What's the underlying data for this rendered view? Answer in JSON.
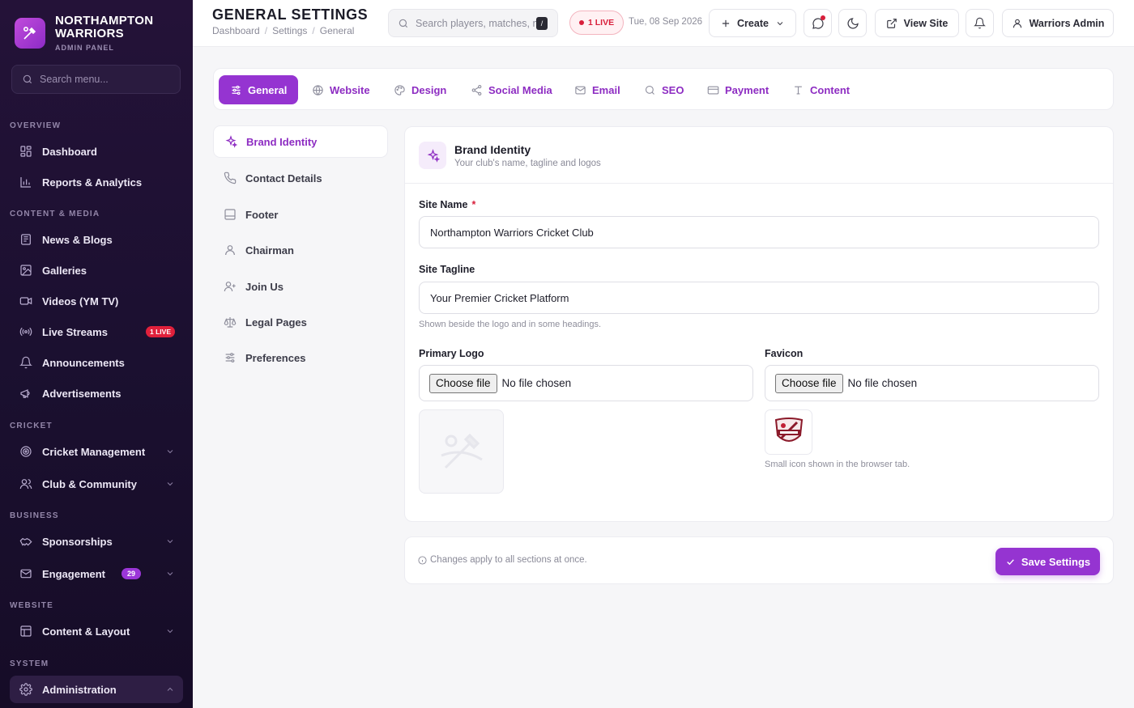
{
  "brand": {
    "name": "NORTHAMPTON WARRIORS",
    "subtitle": "ADMIN PANEL"
  },
  "sidebar": {
    "search_placeholder": "Search menu...",
    "sections": {
      "overview": "OVERVIEW",
      "content_media": "CONTENT & MEDIA",
      "cricket": "CRICKET",
      "business": "BUSINESS",
      "website": "WEBSITE",
      "system": "SYSTEM"
    },
    "items": {
      "dashboard": "Dashboard",
      "reports": "Reports & Analytics",
      "news": "News & Blogs",
      "galleries": "Galleries",
      "videos": "Videos (YM TV)",
      "live_streams": "Live Streams",
      "live_badge": "1 LIVE",
      "announcements": "Announcements",
      "advertisements": "Advertisements",
      "cricket_mgmt": "Cricket Management",
      "club": "Club & Community",
      "sponsorships": "Sponsorships",
      "engagement": "Engagement",
      "engagement_count": "29",
      "content_layout": "Content & Layout",
      "administration": "Administration"
    }
  },
  "header": {
    "title": "GENERAL SETTINGS",
    "breadcrumb": [
      "Dashboard",
      "Settings",
      "General"
    ],
    "breadcrumb_sep": "/",
    "search_placeholder": "Search players, matches, n",
    "search_shortcut": "/",
    "live": "1 LIVE",
    "date": "Tue, 08 Sep 2026",
    "create": "Create",
    "view_site": "View Site",
    "user": "Warriors Admin"
  },
  "tabs": [
    "General",
    "Website",
    "Design",
    "Social Media",
    "Email",
    "SEO",
    "Payment",
    "Content"
  ],
  "subnav": [
    "Brand Identity",
    "Contact Details",
    "Footer",
    "Chairman",
    "Join Us",
    "Legal Pages",
    "Preferences"
  ],
  "card": {
    "title": "Brand Identity",
    "subtitle": "Your club's name, tagline and logos",
    "site_name_label": "Site Name",
    "required_mark": "*",
    "site_name_value": "Northampton Warriors Cricket Club",
    "site_tagline_label": "Site Tagline",
    "site_tagline_value": "Your Premier Cricket Platform",
    "tagline_hint": "Shown beside the logo and in some headings.",
    "primary_logo_label": "Primary Logo",
    "favicon_label": "Favicon",
    "choose_file": "Choose file",
    "no_file": "No file chosen",
    "favicon_hint": "Small icon shown in the browser tab."
  },
  "savebar": {
    "note": "Changes apply to all sections at once.",
    "save": "Save Settings"
  },
  "colors": {
    "accent": "#9534d1",
    "sidebar_bg": "#1b1030",
    "live_red": "#d81f3b"
  }
}
